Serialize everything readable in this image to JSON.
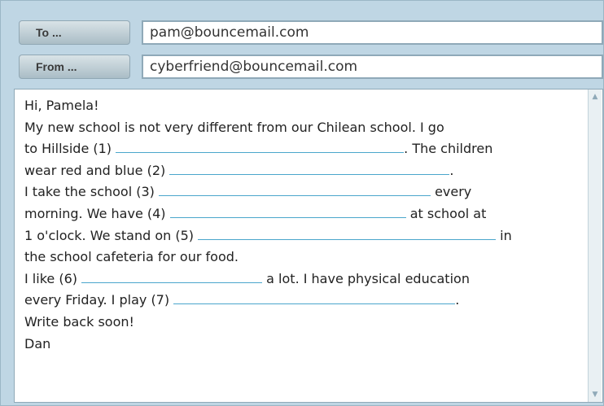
{
  "header": {
    "to_label": "To ...",
    "to_value": "pam@bouncemail.com",
    "from_label": "From ...",
    "from_value": "cyberfriend@bouncemail.com"
  },
  "message": {
    "lines": [
      [
        "Hi, Pamela!"
      ],
      [
        "My new school is not very different from our Chilean school. I go"
      ],
      [
        "to Hillside (1) ",
        ". The children"
      ],
      [
        "wear red and blue (2) ",
        "."
      ],
      [
        "I take the school (3) ",
        " every"
      ],
      [
        "morning. We have (4) ",
        " at school at"
      ],
      [
        "1 o'clock. We stand on (5) ",
        " in"
      ],
      [
        "the school cafeteria for our food."
      ],
      [
        "I like (6) ",
        " a lot. I have physical education"
      ],
      [
        "every Friday. I play (7) ",
        "."
      ],
      [
        "Write back soon!"
      ],
      [
        "Dan"
      ]
    ]
  },
  "scrollbar": {
    "up_icon": "triangle-up",
    "down_icon": "triangle-down"
  }
}
